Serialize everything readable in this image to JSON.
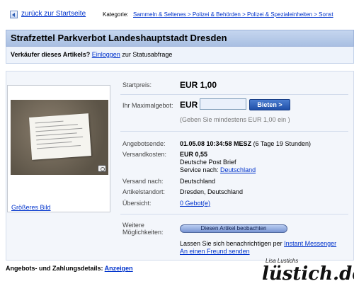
{
  "topbar": {
    "back_link": "zurück zur Startseite",
    "category_label": "Kategorie:",
    "breadcrumb": "Sammeln & Seltenes > Polizei & Behörden > Polizei & Spezialeinheiten > Sonst"
  },
  "item": {
    "title": "Strafzettel Parkverbot Landeshauptstadt Dresden"
  },
  "seller": {
    "prefix": "Verkäufer dieses Artikels?",
    "login_link": "Einloggen",
    "suffix": "zur Statusabfrage"
  },
  "image": {
    "bigger_link": "Größeres Bild"
  },
  "details": {
    "start_price_label": "Startpreis:",
    "start_price": "EUR 1,00",
    "max_bid_label": "Ihr Maximalgebot:",
    "currency": "EUR",
    "bid_input_value": "",
    "bid_button": "Bieten >",
    "bid_hint": "(Geben Sie mindestens EUR 1,00 ein )",
    "end_label": "Angebotsende:",
    "end_date": "01.05.08 10:34:58 MESZ",
    "end_remaining": "(6 Tage 19 Stunden)",
    "shipping_label": "Versandkosten:",
    "shipping_cost": "EUR 0,55",
    "shipping_method": "Deutsche Post Brief",
    "service_prefix": "Service nach:",
    "service_link": "Deutschland",
    "ship_to_label": "Versand nach:",
    "ship_to": "Deutschland",
    "location_label": "Artikelstandort:",
    "location": "Dresden, Deutschland",
    "overview_label": "Übersicht:",
    "overview_link": "0 Gebot(e)",
    "more_label_1": "Weitere",
    "more_label_2": "Möglichkeiten:",
    "watch_button": "Diesen Artikel beobachten",
    "notify_prefix": "Lassen Sie sich benachrichtigen per",
    "notify_link": "Instant Messenger",
    "send_friend_link": "An einen Freund senden"
  },
  "footer": {
    "label": "Angebots- und Zahlungsdetails:",
    "link": "Anzeigen"
  },
  "watermark": {
    "small": "Lisa Lustichs",
    "big": "lüstich.de"
  }
}
